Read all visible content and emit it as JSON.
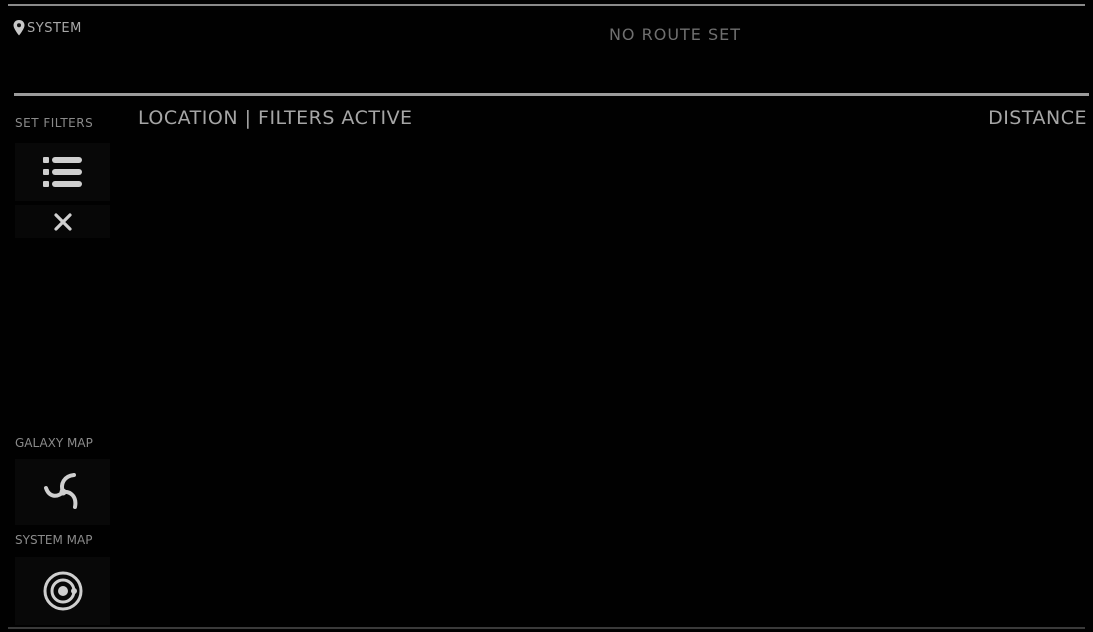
{
  "header": {
    "system_tab_label": "SYSTEM",
    "route_status": "NO ROUTE SET"
  },
  "filters": {
    "section_label": "SET FILTERS",
    "filter_icon": "list-icon",
    "clear_icon": "close-icon"
  },
  "table": {
    "location_header": "LOCATION | FILTERS ACTIVE",
    "distance_header": "DISTANCE",
    "rows": []
  },
  "nav": {
    "galaxy_map_label": "GALAXY MAP",
    "galaxy_map_icon": "galaxy-icon",
    "system_map_label": "SYSTEM MAP",
    "system_map_icon": "system-orbit-icon"
  },
  "colors": {
    "background": "#010101",
    "text": "#a6a6a6",
    "divider": "#9b9b9b"
  }
}
